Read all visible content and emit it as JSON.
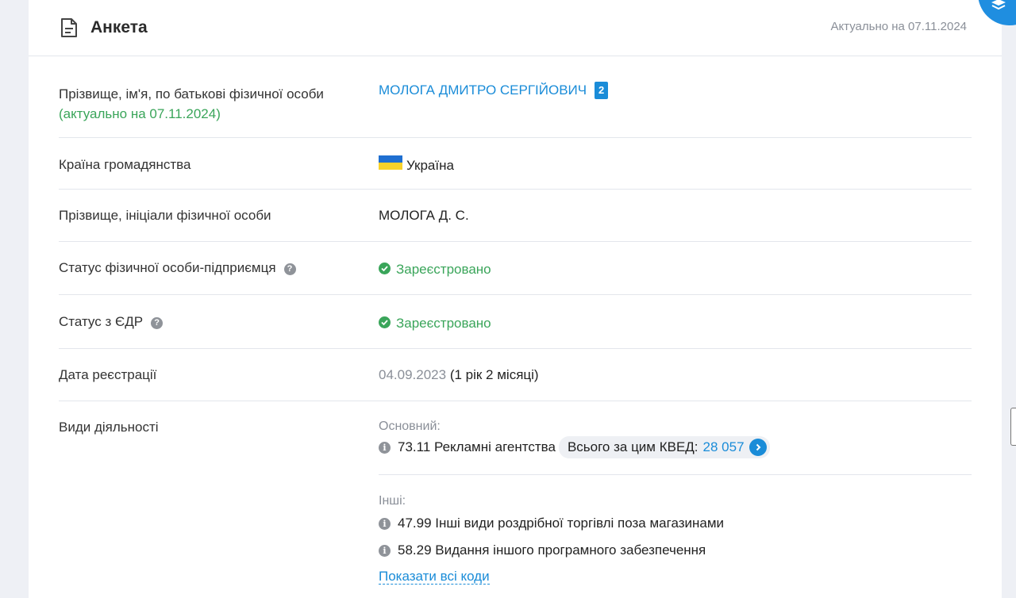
{
  "header": {
    "title": "Анкета",
    "actual_date": "Актуально на 07.11.2024"
  },
  "fields": {
    "full_name": {
      "label": "Прізвище, ім'я, по батькові фізичної особи",
      "sublabel": "(актуально на 07.11.2024)",
      "value": "МОЛОГА ДМИТРО СЕРГІЙОВИЧ",
      "badge": "2"
    },
    "citizenship": {
      "label": "Країна громадянства",
      "value": "Україна"
    },
    "initials": {
      "label": "Прізвище, ініціали фізичної особи",
      "value": "МОЛОГА Д. С."
    },
    "fop_status": {
      "label": "Статус фізичної особи-підприємця",
      "value": "Зареєстровано"
    },
    "edr_status": {
      "label": "Статус з ЄДР",
      "value": "Зареєстровано"
    },
    "registration_date": {
      "label": "Дата реєстрації",
      "date": "04.09.2023",
      "duration": "(1 рік 2 місяці)"
    },
    "activities": {
      "label": "Види діяльності",
      "main_heading": "Основний:",
      "main": {
        "code_text": "73.11 Рекламні агентства",
        "total_label": "Всього за цим КВЕД:",
        "total_count": "28 057"
      },
      "other_heading": "Інші:",
      "others": [
        "47.99 Інші види роздрібної торгівлі поза магазинами",
        "58.29 Видання іншого програмного забезпечення"
      ],
      "show_all": "Показати всі коди"
    }
  },
  "colors": {
    "accent": "#1a8cd8",
    "success": "#3aa55a",
    "muted": "#8a8f98",
    "page_bg": "#eef0f5"
  },
  "icons": [
    "document-icon",
    "help-icon",
    "check-circle-icon",
    "info-icon",
    "ukraine-flag-icon",
    "arrow-right-icon",
    "layers-icon"
  ]
}
